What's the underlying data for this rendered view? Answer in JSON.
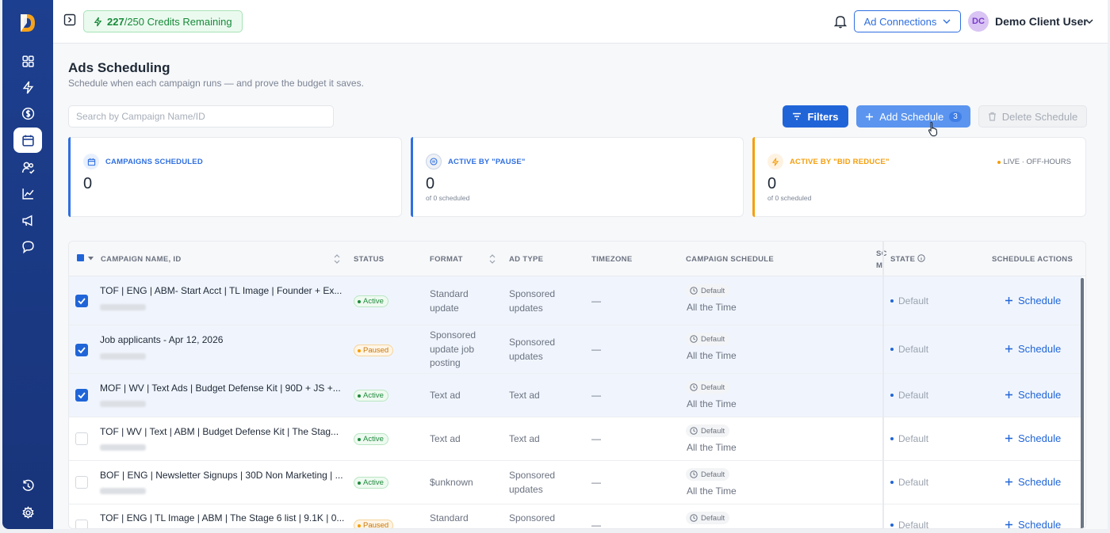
{
  "topbar": {
    "credits_used": "227",
    "credits_total": "/250 Credits Remaining",
    "ad_connections": "Ad Connections",
    "user_initials": "DC",
    "user_name": "Demo Client User"
  },
  "page": {
    "title": "Ads Scheduling",
    "subtitle": "Schedule when each campaign runs — and prove the budget it saves.",
    "search_placeholder": "Search by Campaign Name/ID"
  },
  "actions": {
    "filters": "Filters",
    "add_schedule": "Add Schedule",
    "add_count": "3",
    "delete_schedule": "Delete Schedule"
  },
  "cards": [
    {
      "label": "CAMPAIGNS SCHEDULED",
      "value": "0",
      "sub": "",
      "color": "#2f6fe0"
    },
    {
      "label": "ACTIVE BY \"PAUSE\"",
      "value": "0",
      "sub": "of 0 scheduled",
      "color": "#2f6fe0"
    },
    {
      "label": "ACTIVE BY \"BID REDUCE\"",
      "value": "0",
      "sub": "of 0 scheduled",
      "right": "LIVE · OFF-HOURS",
      "color": "#f59e0b"
    }
  ],
  "table": {
    "headers": {
      "name": "CAMPAIGN NAME, ID",
      "status": "STATUS",
      "format": "FORMAT",
      "ad_type": "AD TYPE",
      "timezone": "TIMEZONE",
      "campaign_schedule": "CAMPAIGN SCHEDULE",
      "sm_top": "SC",
      "sm_bottom": "M",
      "state": "STATE",
      "schedule_actions": "SCHEDULE ACTIONS"
    },
    "rows": [
      {
        "name": "TOF | ENG | ABM- Start Acct | TL Image | Founder + Ex...",
        "status": "Active",
        "format": [
          "Standard",
          "update"
        ],
        "ad_type": [
          "Sponsored",
          "updates"
        ],
        "timezone": "—",
        "schedule_badge": "Default",
        "schedule_time": "All the Time",
        "state": "Default",
        "action": "Schedule",
        "selected": true
      },
      {
        "name": "Job applicants - Apr 12, 2026",
        "status": "Paused",
        "format": [
          "Sponsored",
          "update job",
          "posting"
        ],
        "ad_type": [
          "Sponsored",
          "updates"
        ],
        "timezone": "—",
        "schedule_badge": "Default",
        "schedule_time": "All the Time",
        "state": "Default",
        "action": "Schedule",
        "selected": true
      },
      {
        "name": "MOF | WV | Text Ads | Budget Defense Kit | 90D + JS +...",
        "status": "Active",
        "format": [
          "Text ad"
        ],
        "ad_type": [
          "Text ad"
        ],
        "timezone": "—",
        "schedule_badge": "Default",
        "schedule_time": "All the Time",
        "state": "Default",
        "action": "Schedule",
        "selected": true
      },
      {
        "name": "TOF | WV | Text | ABM | Budget Defense Kit | The Stag...",
        "status": "Active",
        "format": [
          "Text ad"
        ],
        "ad_type": [
          "Text ad"
        ],
        "timezone": "—",
        "schedule_badge": "Default",
        "schedule_time": "All the Time",
        "state": "Default",
        "action": "Schedule",
        "selected": false
      },
      {
        "name": "BOF | ENG | Newsletter Signups | 30D Non Marketing | ...",
        "status": "Active",
        "format": [
          "$unknown"
        ],
        "ad_type": [
          "Sponsored",
          "updates"
        ],
        "timezone": "—",
        "schedule_badge": "Default",
        "schedule_time": "All the Time",
        "state": "Default",
        "action": "Schedule",
        "selected": false
      },
      {
        "name": "TOF | ENG | TL Image | ABM | The Stage 6 list | 9.1K | 0...",
        "status": "Paused",
        "format": [
          "Standard"
        ],
        "ad_type": [
          "Sponsored"
        ],
        "timezone": "—",
        "schedule_badge": "Default",
        "schedule_time": "",
        "state": "Default",
        "action": "Schedule",
        "selected": false
      }
    ]
  },
  "colors": {
    "primary": "#2065d8",
    "sidebar": "#1d3f8f",
    "active": "#1f8a3d",
    "paused": "#c77709"
  }
}
